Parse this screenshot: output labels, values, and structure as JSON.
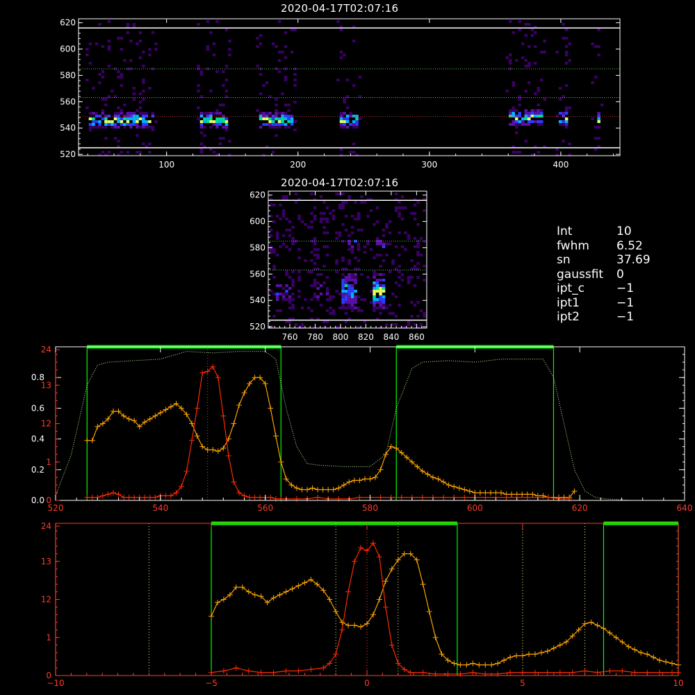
{
  "theme": {
    "background": "#000000",
    "axis": "#ffffff",
    "green_band": "#00ff00",
    "profile_orange": "#ffa500",
    "profile_red": "#ff2a00",
    "reference_dots": "#ffff88"
  },
  "top_image": {
    "title": "2020-04-17T02:07:16",
    "xlim": [
      33,
      445
    ],
    "ylim": [
      519,
      623
    ],
    "xticks": [
      "100",
      "200",
      "300",
      "400"
    ],
    "yticks": [
      "520",
      "540",
      "560",
      "580",
      "600",
      "620"
    ],
    "guide_lines": [
      525,
      548.7,
      563,
      585,
      616
    ],
    "bright_bands": [
      {
        "x": [
          40,
          90
        ],
        "y": 547
      },
      {
        "x": [
          125,
          145
        ],
        "y": 547
      },
      {
        "x": [
          170,
          195
        ],
        "y": 547
      },
      {
        "x": [
          230,
          245
        ],
        "y": 547
      },
      {
        "x": [
          360,
          385
        ],
        "y": 549
      },
      {
        "x": [
          397,
          405
        ],
        "y": 549
      },
      {
        "x": [
          425,
          430
        ],
        "y": 547
      }
    ],
    "colormap": "rainbow"
  },
  "zoom_image": {
    "title": "2020-04-17T02:07:16",
    "xlim": [
      743,
      868
    ],
    "ylim": [
      519,
      623
    ],
    "xticks": [
      "760",
      "780",
      "800",
      "820",
      "840",
      "860"
    ],
    "yticks": [
      "520",
      "540",
      "560",
      "580",
      "600",
      "620"
    ],
    "guide_lines": [
      525,
      563,
      585,
      616
    ]
  },
  "fit_info": [
    {
      "label": "Int",
      "value": "10"
    },
    {
      "label": "fwhm",
      "value": "6.52"
    },
    {
      "label": "sn",
      "value": "37.69"
    },
    {
      "label": "gaussfit",
      "value": "0"
    },
    {
      "label": "ipt_c",
      "value": "−1"
    },
    {
      "label": "ipt1",
      "value": "−1"
    },
    {
      "label": "ipt2",
      "value": "−1"
    }
  ],
  "chart_data": [
    {
      "type": "line",
      "panel": "spectrum",
      "xlim": [
        520,
        640
      ],
      "ylim_left_black": [
        0,
        1.0
      ],
      "ylim_left_red": [
        0,
        24
      ],
      "xticks": [
        "520",
        "540",
        "560",
        "580",
        "600",
        "620",
        "640"
      ],
      "yticks_black": [
        "0.0",
        "0.2",
        "0.4",
        "0.6",
        "0.8"
      ],
      "yticks_red": [
        "0",
        "1",
        "12",
        "13",
        "24"
      ],
      "band_windows": [
        [
          526,
          563
        ],
        [
          585,
          615
        ]
      ],
      "center_line": 549,
      "filter_transmission": {
        "x": [
          520,
          523,
          526,
          528,
          530,
          535,
          540,
          545,
          550,
          555,
          560,
          562,
          564,
          566,
          568,
          570,
          575,
          580,
          583,
          585,
          588,
          590,
          595,
          600,
          605,
          610,
          613,
          615,
          617,
          619,
          621,
          623,
          625,
          630,
          635,
          640
        ],
        "y": [
          0.03,
          0.3,
          0.75,
          0.88,
          0.9,
          0.91,
          0.92,
          0.97,
          0.96,
          0.97,
          0.97,
          0.92,
          0.6,
          0.35,
          0.24,
          0.23,
          0.22,
          0.22,
          0.3,
          0.6,
          0.86,
          0.9,
          0.91,
          0.9,
          0.92,
          0.92,
          0.92,
          0.8,
          0.5,
          0.2,
          0.06,
          0.02,
          0.01,
          0.0,
          0.0,
          0.0
        ]
      },
      "series": [
        {
          "color": "#ffa500",
          "x": [
            526,
            527,
            528,
            529,
            530,
            531,
            532,
            533,
            534,
            535,
            536,
            537,
            538,
            539,
            540,
            541,
            542,
            543,
            544,
            545,
            546,
            547,
            548,
            549,
            550,
            551,
            552,
            553,
            554,
            555,
            556,
            557,
            558,
            559,
            560,
            561,
            562,
            563,
            564,
            565,
            566,
            567,
            568,
            569,
            570,
            571,
            572,
            573,
            574,
            575,
            576,
            577,
            578,
            579,
            580,
            581,
            582,
            583,
            584,
            585,
            586,
            587,
            588,
            589,
            590,
            591,
            592,
            593,
            594,
            595,
            596,
            597,
            598,
            599,
            600,
            601,
            602,
            603,
            604,
            605,
            606,
            607,
            608,
            609,
            610,
            611,
            612,
            613,
            614,
            615,
            616,
            617,
            618,
            619
          ],
          "y": [
            0.39,
            0.39,
            0.48,
            0.5,
            0.53,
            0.58,
            0.58,
            0.55,
            0.53,
            0.52,
            0.48,
            0.51,
            0.53,
            0.55,
            0.57,
            0.59,
            0.61,
            0.63,
            0.6,
            0.56,
            0.5,
            0.42,
            0.35,
            0.33,
            0.33,
            0.32,
            0.34,
            0.4,
            0.5,
            0.62,
            0.7,
            0.76,
            0.8,
            0.8,
            0.76,
            0.6,
            0.42,
            0.25,
            0.14,
            0.1,
            0.08,
            0.07,
            0.07,
            0.08,
            0.07,
            0.07,
            0.07,
            0.07,
            0.08,
            0.1,
            0.12,
            0.13,
            0.13,
            0.14,
            0.14,
            0.15,
            0.2,
            0.3,
            0.35,
            0.34,
            0.31,
            0.28,
            0.25,
            0.22,
            0.19,
            0.17,
            0.15,
            0.14,
            0.12,
            0.1,
            0.09,
            0.08,
            0.07,
            0.06,
            0.05,
            0.05,
            0.05,
            0.05,
            0.05,
            0.05,
            0.04,
            0.04,
            0.04,
            0.04,
            0.04,
            0.04,
            0.03,
            0.03,
            0.02,
            0.02,
            0.02,
            0.02,
            0.02,
            0.06
          ]
        },
        {
          "color": "#ff2a00",
          "x": [
            526,
            527,
            528,
            529,
            530,
            531,
            532,
            533,
            534,
            535,
            536,
            537,
            538,
            539,
            540,
            541,
            542,
            543,
            544,
            545,
            546,
            547,
            548,
            549,
            550,
            551,
            552,
            553,
            554,
            555,
            556,
            557,
            558,
            559,
            560,
            561,
            562,
            563,
            564,
            566,
            568,
            570,
            572,
            574,
            576,
            578,
            580,
            582,
            584,
            586,
            588,
            590,
            592,
            594,
            596,
            598,
            600,
            602,
            604,
            606,
            608,
            610,
            612,
            614,
            616,
            618
          ],
          "y": [
            0.02,
            0.02,
            0.02,
            0.03,
            0.04,
            0.05,
            0.04,
            0.02,
            0.02,
            0.02,
            0.02,
            0.02,
            0.02,
            0.02,
            0.03,
            0.03,
            0.03,
            0.05,
            0.09,
            0.19,
            0.39,
            0.6,
            0.83,
            0.84,
            0.87,
            0.8,
            0.55,
            0.29,
            0.12,
            0.05,
            0.03,
            0.02,
            0.02,
            0.02,
            0.02,
            0.02,
            0.01,
            0.01,
            0.01,
            0.01,
            0.01,
            0.02,
            0.01,
            0.01,
            0.01,
            0.02,
            0.02,
            0.02,
            0.02,
            0.02,
            0.02,
            0.02,
            0.02,
            0.02,
            0.02,
            0.02,
            0.02,
            0.02,
            0.02,
            0.02,
            0.02,
            0.02,
            0.02,
            0.02,
            0.01,
            0.01
          ]
        }
      ]
    },
    {
      "type": "line",
      "panel": "velocity",
      "xlim": [
        -10,
        10
      ],
      "ylim_left_red": [
        0,
        24
      ],
      "xticks": [
        "−10",
        "−5",
        "0",
        "5",
        "10"
      ],
      "yticks_red": [
        "0",
        "1",
        "12",
        "13",
        "24"
      ],
      "band_windows": [
        [
          -5,
          2.9
        ],
        [
          7.6,
          10
        ]
      ],
      "reference_lines": [
        -7,
        -1,
        1,
        5,
        7
      ],
      "center_line": 0,
      "series": [
        {
          "color": "#ffa500",
          "x": [
            -5,
            -4.8,
            -4.6,
            -4.4,
            -4.2,
            -4,
            -3.8,
            -3.6,
            -3.4,
            -3.2,
            -3,
            -2.8,
            -2.6,
            -2.4,
            -2.2,
            -2,
            -1.8,
            -1.6,
            -1.4,
            -1.2,
            -1,
            -0.8,
            -0.6,
            -0.4,
            -0.2,
            0,
            0.2,
            0.4,
            0.6,
            0.8,
            1,
            1.2,
            1.4,
            1.6,
            1.8,
            2,
            2.2,
            2.4,
            2.6,
            2.8,
            3,
            3.2,
            3.4,
            3.6,
            3.8,
            4,
            4.2,
            4.4,
            4.6,
            4.8,
            5,
            5.2,
            5.4,
            5.6,
            5.8,
            6,
            6.2,
            6.4,
            6.6,
            6.8,
            7,
            7.2,
            7.4,
            7.6,
            7.8,
            8,
            8.2,
            8.4,
            8.6,
            8.8,
            9,
            9.2,
            9.4,
            9.6,
            9.8,
            10
          ],
          "y": [
            0.39,
            0.48,
            0.5,
            0.53,
            0.58,
            0.58,
            0.55,
            0.53,
            0.52,
            0.48,
            0.51,
            0.53,
            0.55,
            0.57,
            0.59,
            0.61,
            0.63,
            0.6,
            0.56,
            0.5,
            0.42,
            0.35,
            0.33,
            0.33,
            0.32,
            0.34,
            0.4,
            0.5,
            0.62,
            0.7,
            0.76,
            0.8,
            0.8,
            0.76,
            0.6,
            0.42,
            0.25,
            0.14,
            0.1,
            0.08,
            0.07,
            0.07,
            0.08,
            0.07,
            0.07,
            0.07,
            0.08,
            0.1,
            0.12,
            0.13,
            0.13,
            0.14,
            0.14,
            0.15,
            0.16,
            0.18,
            0.2,
            0.22,
            0.26,
            0.3,
            0.34,
            0.35,
            0.33,
            0.31,
            0.28,
            0.25,
            0.22,
            0.19,
            0.17,
            0.15,
            0.14,
            0.12,
            0.1,
            0.09,
            0.08,
            0.07
          ]
        },
        {
          "color": "#ff2a00",
          "x": [
            -5,
            -4.6,
            -4.2,
            -3.8,
            -3.4,
            -3,
            -2.6,
            -2.2,
            -1.8,
            -1.4,
            -1.2,
            -1,
            -0.8,
            -0.6,
            -0.4,
            -0.2,
            0,
            0.2,
            0.4,
            0.6,
            0.8,
            1,
            1.2,
            1.4,
            1.8,
            2.2,
            2.6,
            3,
            3.4,
            3.8,
            4.2,
            4.6,
            5,
            5.4,
            5.8,
            6.2,
            6.6,
            7,
            7.4,
            7.8,
            8.2,
            8.6,
            9,
            9.4,
            9.8,
            10
          ],
          "y": [
            0.02,
            0.03,
            0.05,
            0.03,
            0.02,
            0.02,
            0.03,
            0.03,
            0.04,
            0.05,
            0.08,
            0.14,
            0.3,
            0.55,
            0.75,
            0.84,
            0.82,
            0.87,
            0.78,
            0.45,
            0.2,
            0.08,
            0.04,
            0.02,
            0.02,
            0.01,
            0.01,
            0.01,
            0.02,
            0.01,
            0.01,
            0.02,
            0.02,
            0.02,
            0.02,
            0.02,
            0.02,
            0.03,
            0.02,
            0.03,
            0.03,
            0.02,
            0.02,
            0.02,
            0.02,
            0.02
          ]
        }
      ]
    }
  ]
}
